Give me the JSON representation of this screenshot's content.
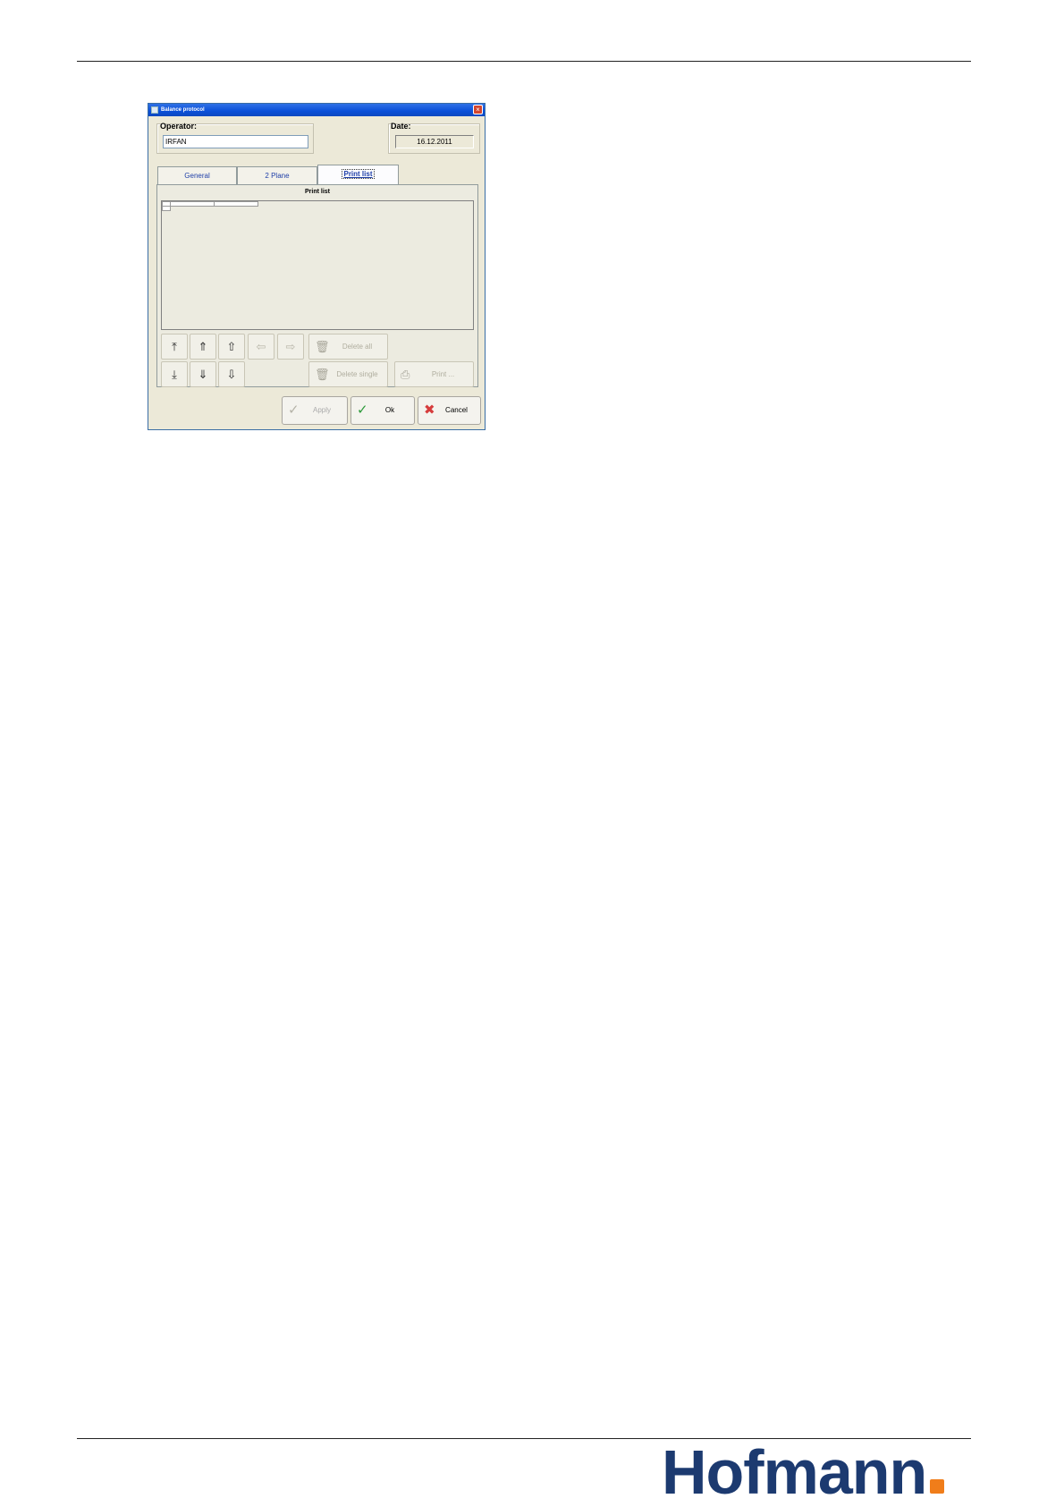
{
  "window": {
    "title": "Balance protocol",
    "close_glyph": "×"
  },
  "operator": {
    "label": "Operator:",
    "value": "IRFAN"
  },
  "date": {
    "label": "Date:",
    "value": "16.12.2011"
  },
  "tabs": [
    {
      "label": "General"
    },
    {
      "label": "2 Plane"
    },
    {
      "label": "Print list",
      "active": true
    }
  ],
  "print_list": {
    "title": "Print list"
  },
  "toolbar": {
    "delete_all": "Delete all",
    "delete_single": "Delete single",
    "print": "Print ..."
  },
  "buttons": {
    "apply": "Apply",
    "ok": "Ok",
    "cancel": "Cancel"
  },
  "brand": {
    "name": "Hofmann",
    "accent": "#f07d1a",
    "color": "#1c3a70"
  }
}
